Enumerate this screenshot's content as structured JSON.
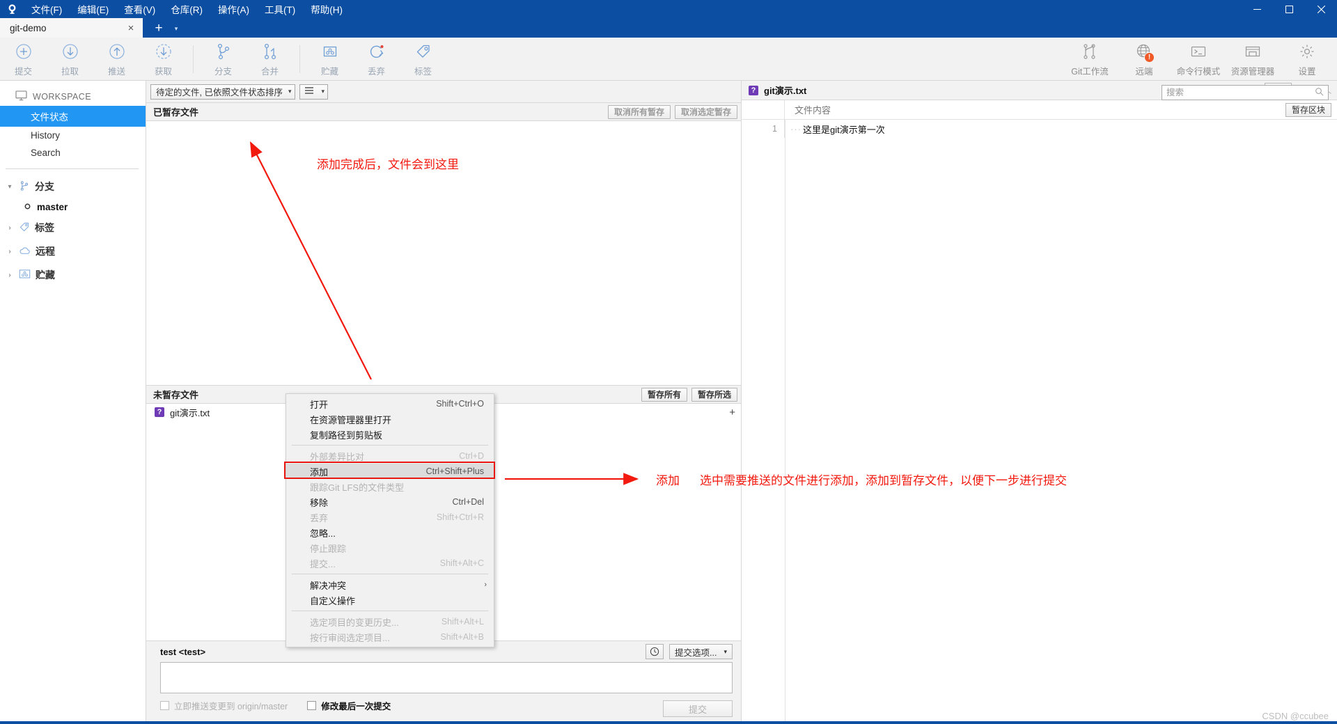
{
  "window": {
    "app_icon": "sourcetree-logo-icon",
    "menus": [
      "文件(F)",
      "编辑(E)",
      "查看(V)",
      "仓库(R)",
      "操作(A)",
      "工具(T)",
      "帮助(H)"
    ],
    "controls": {
      "minimize": "minimize-icon",
      "maximize": "maximize-icon",
      "close": "close-icon"
    }
  },
  "tabs": {
    "items": [
      {
        "label": "git-demo",
        "close": "×"
      }
    ],
    "new_tab": "+",
    "tab_list_arrow": "▾"
  },
  "toolbar": {
    "left": [
      {
        "label": "提交",
        "icon": "commit-plus-icon"
      },
      {
        "label": "拉取",
        "icon": "pull-down-arrow-icon"
      },
      {
        "label": "推送",
        "icon": "push-up-arrow-icon"
      },
      {
        "label": "获取",
        "icon": "fetch-dashed-arrow-icon"
      },
      {
        "label": "分支",
        "icon": "branch-icon"
      },
      {
        "label": "合并",
        "icon": "merge-icon"
      },
      {
        "label": "贮藏",
        "icon": "stash-box-icon"
      },
      {
        "label": "丢弃",
        "icon": "discard-refresh-icon"
      },
      {
        "label": "标签",
        "icon": "tag-icon"
      }
    ],
    "right": [
      {
        "label": "Git工作流",
        "icon": "gitflow-icon"
      },
      {
        "label": "远端",
        "icon": "globe-remote-icon",
        "badge": "!"
      },
      {
        "label": "命令行模式",
        "icon": "terminal-icon"
      },
      {
        "label": "资源管理器",
        "icon": "folder-explorer-icon"
      },
      {
        "label": "设置",
        "icon": "gear-settings-icon"
      }
    ]
  },
  "search": {
    "placeholder": "搜索",
    "value": "",
    "icon": "search-icon"
  },
  "sidebar": {
    "workspace": {
      "label": "WORKSPACE",
      "icon": "monitor-icon"
    },
    "workspace_items": [
      {
        "label": "文件状态",
        "active": true
      },
      {
        "label": "History",
        "active": false
      },
      {
        "label": "Search",
        "active": false
      }
    ],
    "groups": [
      {
        "label": "分支",
        "icon": "branch-icon",
        "caret": "▾",
        "expanded": true,
        "children": [
          {
            "label": "master",
            "icon": "branch-dot-icon"
          }
        ]
      },
      {
        "label": "标签",
        "icon": "tag-icon",
        "caret": "›",
        "expanded": false,
        "children": []
      },
      {
        "label": "远程",
        "icon": "cloud-icon",
        "caret": "›",
        "expanded": false,
        "children": []
      },
      {
        "label": "贮藏",
        "icon": "stash-box-icon",
        "caret": "›",
        "expanded": false,
        "children": []
      }
    ]
  },
  "filterbar": {
    "sort_combo": {
      "value": "待定的文件, 已依照文件状态排序",
      "caret": "▾"
    },
    "view_combo": {
      "icon": "list-view-icon",
      "caret": "▾"
    }
  },
  "staged": {
    "title": "已暂存文件",
    "buttons": [
      {
        "label": "取消所有暂存",
        "enabled": false
      },
      {
        "label": "取消选定暂存",
        "enabled": false
      }
    ],
    "files": []
  },
  "unstaged": {
    "title": "未暂存文件",
    "buttons": [
      {
        "label": "暂存所有",
        "enabled": true
      },
      {
        "label": "暂存所选",
        "enabled": true
      }
    ],
    "files": [
      {
        "name": "git演示.txt",
        "status_icon": "unknown-question-icon",
        "add": "+"
      }
    ]
  },
  "commit": {
    "author": "test <test>",
    "message_value": "",
    "message_placeholder": "",
    "push_checkbox": {
      "label": "立即推送变更到 origin/master",
      "checked": false,
      "enabled": false
    },
    "amend_checkbox": {
      "label": "修改最后一次提交",
      "checked": false,
      "enabled": true
    },
    "history_icon": "clock-history-icon",
    "options_button": {
      "label": "提交选项...",
      "caret": "▾"
    },
    "commit_button": {
      "label": "提交",
      "enabled": false
    }
  },
  "diff_panel": {
    "file_icon": "unknown-question-icon",
    "file_name": "git演示.txt",
    "gear": {
      "icon": "gear-settings-icon",
      "caret": "▾"
    },
    "more": "•••",
    "collapse": "︿",
    "content_header": "文件内容",
    "hunk_button": "暂存区块",
    "lines": [
      {
        "num": "1",
        "lead": "···",
        "text": "这里是git演示第一次"
      }
    ]
  },
  "context_menu": {
    "items": [
      {
        "label": "打开",
        "shortcut": "Shift+Ctrl+O",
        "disabled": false,
        "type": "item"
      },
      {
        "label": "在资源管理器里打开",
        "shortcut": "",
        "disabled": false,
        "type": "item"
      },
      {
        "label": "复制路径到剪贴板",
        "shortcut": "",
        "disabled": false,
        "type": "item"
      },
      {
        "type": "separator"
      },
      {
        "label": "外部差异比对",
        "shortcut": "Ctrl+D",
        "disabled": true,
        "type": "item"
      },
      {
        "label": "添加",
        "shortcut": "Ctrl+Shift+Plus",
        "disabled": false,
        "type": "item",
        "highlight": true
      },
      {
        "label": "跟踪Git LFS的文件类型",
        "shortcut": "",
        "disabled": true,
        "type": "item"
      },
      {
        "label": "移除",
        "shortcut": "Ctrl+Del",
        "disabled": false,
        "type": "item"
      },
      {
        "label": "丢弃",
        "shortcut": "Shift+Ctrl+R",
        "disabled": true,
        "type": "item"
      },
      {
        "label": "忽略...",
        "shortcut": "",
        "disabled": false,
        "type": "item"
      },
      {
        "label": "停止跟踪",
        "shortcut": "",
        "disabled": true,
        "type": "item"
      },
      {
        "label": "提交...",
        "shortcut": "Shift+Alt+C",
        "disabled": true,
        "type": "item"
      },
      {
        "type": "separator"
      },
      {
        "label": "解决冲突",
        "shortcut": "",
        "disabled": false,
        "type": "submenu",
        "arrow": "›"
      },
      {
        "label": "自定义操作",
        "shortcut": "",
        "disabled": false,
        "type": "item"
      },
      {
        "type": "separator"
      },
      {
        "label": "选定项目的变更历史...",
        "shortcut": "Shift+Alt+L",
        "disabled": true,
        "type": "item"
      },
      {
        "label": "按行审阅选定项目...",
        "shortcut": "Shift+Alt+B",
        "disabled": true,
        "type": "item"
      }
    ]
  },
  "annotations": {
    "color": "#f2190e",
    "note_top": "添加完成后，文件会到这里",
    "note_add_label": "添加",
    "note_add_text": "选中需要推送的文件进行添加，添加到暂存文件，以便下一步进行提交"
  },
  "watermark": "CSDN @ccubee"
}
